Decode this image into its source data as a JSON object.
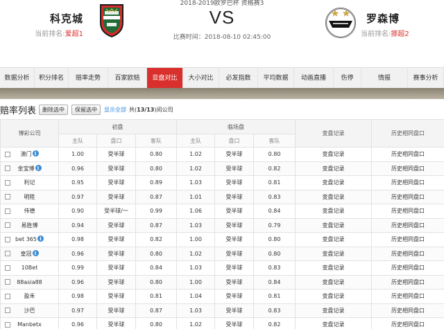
{
  "match": {
    "title": "2018-2019欧罗巴杯 资格赛3",
    "vs": "VS",
    "time_label": "比赛时间：",
    "time_value": "2018-08-10 02:45:00",
    "home": {
      "name": "科克城",
      "rank_label": "当前排名:",
      "rank_value": "爱超1"
    },
    "away": {
      "name": "罗森博",
      "rank_label": "当前排名:",
      "rank_value": "挪超2"
    }
  },
  "nav": {
    "tabs": [
      "数据分析",
      "积分排名",
      "赔率走势",
      "百家欧赔",
      "亚盘对比",
      "大小对比",
      "必发指数",
      "平均数据",
      "动画直播",
      "伤停",
      "情报",
      "赛事分析"
    ],
    "active_index": 4
  },
  "toolbar": {
    "title": "赔率列表",
    "delete_selected": "删除选中",
    "keep_selected": "保留选中",
    "show_all": "显示全部",
    "count_prefix": "共(",
    "count_value": "13/13",
    "count_suffix": ")间公司"
  },
  "table": {
    "company_header": "博彩公司",
    "initial_header": "初盘",
    "live_header": "临场盘",
    "change_header": "变盘记录",
    "history_header": "历史相同盘口",
    "sub_home": "主队",
    "sub_line": "盘口",
    "sub_away": "客队",
    "rows": [
      {
        "company": "澳门",
        "info": true,
        "init_home": "1.00",
        "init_line": "受半球",
        "init_away": "0.80",
        "live_home": "1.02",
        "live_line": "受半球",
        "live_away": "0.80",
        "change": "变盘记录",
        "history": "历史相同盘口"
      },
      {
        "company": "金宝博",
        "info": true,
        "init_home": "0.96",
        "init_line": "受半球",
        "init_away": "0.80",
        "live_home": "1.02",
        "live_line": "受半球",
        "live_away": "0.82",
        "change": "变盘记录",
        "history": "历史相同盘口"
      },
      {
        "company": "利记",
        "info": false,
        "init_home": "0.95",
        "init_line": "受半球",
        "init_away": "0.89",
        "live_home": "1.03",
        "live_line": "受半球",
        "live_away": "0.81",
        "change": "变盘记录",
        "history": "历史相同盘口"
      },
      {
        "company": "明陞",
        "info": false,
        "init_home": "0.97",
        "init_line": "受半球",
        "init_away": "0.87",
        "live_home": "1.01",
        "live_line": "受半球",
        "live_away": "0.83",
        "change": "变盘记录",
        "history": "历史相同盘口"
      },
      {
        "company": "伟德",
        "info": false,
        "init_home": "0.90",
        "init_line": "受半球/一",
        "init_away": "0.99",
        "live_home": "1.06",
        "live_line": "受半球",
        "live_away": "0.84",
        "change": "变盘记录",
        "history": "历史相同盘口"
      },
      {
        "company": "易胜博",
        "info": false,
        "init_home": "0.94",
        "init_line": "受半球",
        "init_away": "0.87",
        "live_home": "1.03",
        "live_line": "受半球",
        "live_away": "0.79",
        "change": "变盘记录",
        "history": "历史相同盘口"
      },
      {
        "company": "bet 365",
        "info": true,
        "init_home": "0.98",
        "init_line": "受半球",
        "init_away": "0.82",
        "live_home": "1.00",
        "live_line": "受半球",
        "live_away": "0.80",
        "change": "变盘记录",
        "history": "历史相同盘口"
      },
      {
        "company": "皇冠",
        "info": true,
        "init_home": "0.96",
        "init_line": "受半球",
        "init_away": "0.80",
        "live_home": "1.02",
        "live_line": "受半球",
        "live_away": "0.80",
        "change": "变盘记录",
        "history": "历史相同盘口"
      },
      {
        "company": "10Bet",
        "info": false,
        "init_home": "0.99",
        "init_line": "受半球",
        "init_away": "0.84",
        "live_home": "1.03",
        "live_line": "受半球",
        "live_away": "0.83",
        "change": "变盘记录",
        "history": "历史相同盘口"
      },
      {
        "company": "88asia88",
        "info": false,
        "init_home": "0.96",
        "init_line": "受半球",
        "init_away": "0.80",
        "live_home": "1.00",
        "live_line": "受半球",
        "live_away": "0.84",
        "change": "变盘记录",
        "history": "历史相同盘口"
      },
      {
        "company": "盈禾",
        "info": false,
        "init_home": "0.98",
        "init_line": "受半球",
        "init_away": "0.81",
        "live_home": "1.04",
        "live_line": "受半球",
        "live_away": "0.81",
        "change": "变盘记录",
        "history": "历史相同盘口"
      },
      {
        "company": "沙巴",
        "info": false,
        "init_home": "0.97",
        "init_line": "受半球",
        "init_away": "0.87",
        "live_home": "1.03",
        "live_line": "受半球",
        "live_away": "0.83",
        "change": "变盘记录",
        "history": "历史相同盘口"
      },
      {
        "company": "Manbetx",
        "info": false,
        "init_home": "0.96",
        "init_line": "受半球",
        "init_away": "0.80",
        "live_home": "1.02",
        "live_line": "受半球",
        "live_away": "0.82",
        "change": "变盘记录",
        "history": "历史相同盘口"
      }
    ]
  },
  "colors": {
    "accent": "#d9302d",
    "link": "#3a8bd8"
  }
}
